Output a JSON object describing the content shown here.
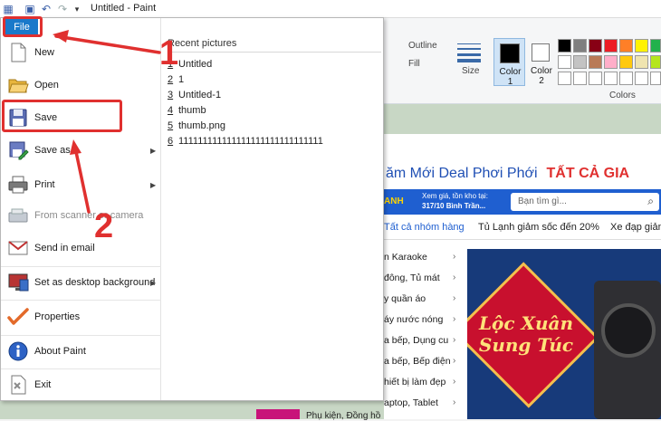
{
  "window": {
    "title": "Untitled - Paint"
  },
  "file_tab": {
    "label": "File"
  },
  "ribbon": {
    "outline": "Outline",
    "fill": "Fill",
    "size": "Size",
    "color1": "Color 1",
    "color2": "Color 2",
    "colors_group": "Colors"
  },
  "menu": {
    "items": [
      {
        "label": "New"
      },
      {
        "label": "Open"
      },
      {
        "label": "Save"
      },
      {
        "label": "Save as"
      },
      {
        "label": "Print"
      },
      {
        "label": "From scanner or camera"
      },
      {
        "label": "Send in email"
      },
      {
        "label": "Set as desktop background"
      },
      {
        "label": "Properties"
      },
      {
        "label": "About Paint"
      },
      {
        "label": "Exit"
      }
    ],
    "recent_title": "Recent pictures",
    "recent": [
      {
        "num": "1",
        "name": "Untitled"
      },
      {
        "num": "2",
        "name": "1"
      },
      {
        "num": "3",
        "name": "Untitled-1"
      },
      {
        "num": "4",
        "name": "thumb"
      },
      {
        "num": "5",
        "name": "thumb.png"
      },
      {
        "num": "6",
        "name": "111111111111111111111111111111"
      }
    ]
  },
  "annotations": {
    "one": "1",
    "two": "2"
  },
  "web": {
    "banner": "ăm Mới Deal Phơi Phới",
    "banner_right": "TẤT CẢ GIA",
    "brand_fragment": "ANH",
    "stock_line1": "Xem giá, tồn kho tại:",
    "stock_line2": "317/10 Bình Trần...",
    "search_placeholder": "Bạn tìm gì...",
    "nav": [
      "Tất cả nhóm hàng",
      "Tủ Lạnh giảm sốc đến 20%",
      "Xe đạp giản"
    ],
    "categories": [
      "n Karaoke",
      "đông, Tủ mát",
      "y quần áo",
      "áy nước nóng",
      "a bếp, Dụng cu",
      "a bếp, Bếp điện",
      "hiết bị làm đẹp",
      "aptop, Tablet",
      "Phụ kiện, Đồng hồ"
    ],
    "promo": "Lộc Xuân Sung Túc"
  }
}
